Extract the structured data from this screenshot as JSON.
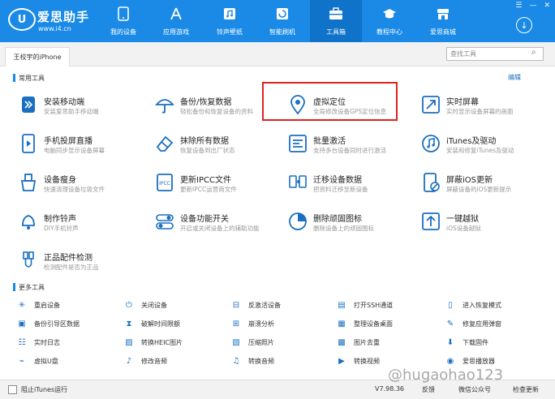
{
  "app": {
    "brand": "爱思助手",
    "url": "www.i4.cn",
    "logo_text": "U"
  },
  "nav": [
    {
      "label": "我的设备",
      "icon": "phone-icon"
    },
    {
      "label": "应用游戏",
      "icon": "apps-icon"
    },
    {
      "label": "铃声壁纸",
      "icon": "music-icon"
    },
    {
      "label": "智能刷机",
      "icon": "flash-icon"
    },
    {
      "label": "工具箱",
      "icon": "toolbox-icon",
      "active": true
    },
    {
      "label": "教程中心",
      "icon": "graduation-icon"
    },
    {
      "label": "爱思商城",
      "icon": "store-icon"
    }
  ],
  "window": {
    "menu": "☰",
    "min": "—",
    "close": "✕"
  },
  "tabbar": {
    "device_tab": "王校宇的iPhone",
    "search_placeholder": "查找工具"
  },
  "common": {
    "title": "常用工具",
    "edit": "编辑",
    "tools": [
      {
        "name": "安装移动端",
        "desc": "安装爱思助手移动端",
        "icon": "i4-install-icon"
      },
      {
        "name": "备份/恢复数据",
        "desc": "轻松备份和恢复设备的资料",
        "icon": "umbrella-icon"
      },
      {
        "name": "虚拟定位",
        "desc": "全局修改设备GPS定位信息",
        "icon": "location-pin-icon"
      },
      {
        "name": "实时屏幕",
        "desc": "实时显示设备屏幕的画面",
        "icon": "screen-mirror-icon"
      },
      {
        "name": "手机投屏直播",
        "desc": "电脑同步显示设备屏幕",
        "icon": "phone-play-icon"
      },
      {
        "name": "抹除所有数据",
        "desc": "恢复设备到出厂状态",
        "icon": "eraser-icon"
      },
      {
        "name": "批量激活",
        "desc": "支持多台设备同时进行激活",
        "icon": "batch-activate-icon"
      },
      {
        "name": "iTunes及驱动",
        "desc": "安装和修复iTunes及驱动",
        "icon": "itunes-icon"
      },
      {
        "name": "设备瘦身",
        "desc": "快速清理设备垃圾文件",
        "icon": "broom-icon"
      },
      {
        "name": "更新IPCC文件",
        "desc": "更新IPCC运营商文件",
        "icon": "ipcc-icon"
      },
      {
        "name": "迁移设备数据",
        "desc": "把资料迁移至新设备",
        "icon": "migrate-icon"
      },
      {
        "name": "屏蔽iOS更新",
        "desc": "屏蔽设备的iOS更新提示",
        "icon": "block-update-icon"
      },
      {
        "name": "制作铃声",
        "desc": "DIY手机铃声",
        "icon": "bell-icon"
      },
      {
        "name": "设备功能开关",
        "desc": "开启或关闭设备上的辅助功能",
        "icon": "toggle-icon"
      },
      {
        "name": "删除顽固图标",
        "desc": "删除设备上的顽固图标",
        "icon": "pie-icon"
      },
      {
        "name": "一键越狱",
        "desc": "iOS设备越狱",
        "icon": "jailbreak-icon"
      },
      {
        "name": "正品配件检测",
        "desc": "检测配件是否为正品",
        "icon": "cable-icon"
      }
    ]
  },
  "more": {
    "title": "更多工具",
    "items": [
      {
        "label": "重启设备",
        "icon": "restart-icon"
      },
      {
        "label": "关闭设备",
        "icon": "power-icon"
      },
      {
        "label": "反激活设备",
        "icon": "deactivate-icon"
      },
      {
        "label": "打开SSH通道",
        "icon": "ssh-icon"
      },
      {
        "label": "进入恢复模式",
        "icon": "recovery-icon"
      },
      {
        "label": "备份引导区数据",
        "icon": "backup-boot-icon"
      },
      {
        "label": "破解时间限额",
        "icon": "hourglass-icon"
      },
      {
        "label": "崩溃分析",
        "icon": "crash-icon"
      },
      {
        "label": "整理设备桌面",
        "icon": "desktop-icon"
      },
      {
        "label": "修复应用弹窗",
        "icon": "repair-icon"
      },
      {
        "label": "实时日志",
        "icon": "log-icon"
      },
      {
        "label": "转换HEIC图片",
        "icon": "heic-icon"
      },
      {
        "label": "压缩照片",
        "icon": "compress-icon"
      },
      {
        "label": "图片去重",
        "icon": "dedupe-icon"
      },
      {
        "label": "下载固件",
        "icon": "firmware-icon"
      },
      {
        "label": "虚拟U盘",
        "icon": "usb-icon"
      },
      {
        "label": "修改音频",
        "icon": "audio-icon"
      },
      {
        "label": "转换音频",
        "icon": "convert-audio-icon"
      },
      {
        "label": "转换视频",
        "icon": "video-icon"
      },
      {
        "label": "爱思播放器",
        "icon": "player-icon"
      }
    ]
  },
  "status": {
    "checkbox_label": "阻止iTunes运行",
    "version": "V7.98.36",
    "feedback": "反馈",
    "wechat": "微信公众号",
    "update": "检查更新"
  },
  "watermark": "@hugaohao123",
  "colors": {
    "accent": "#1a8ae6",
    "highlight": "#e02020"
  }
}
